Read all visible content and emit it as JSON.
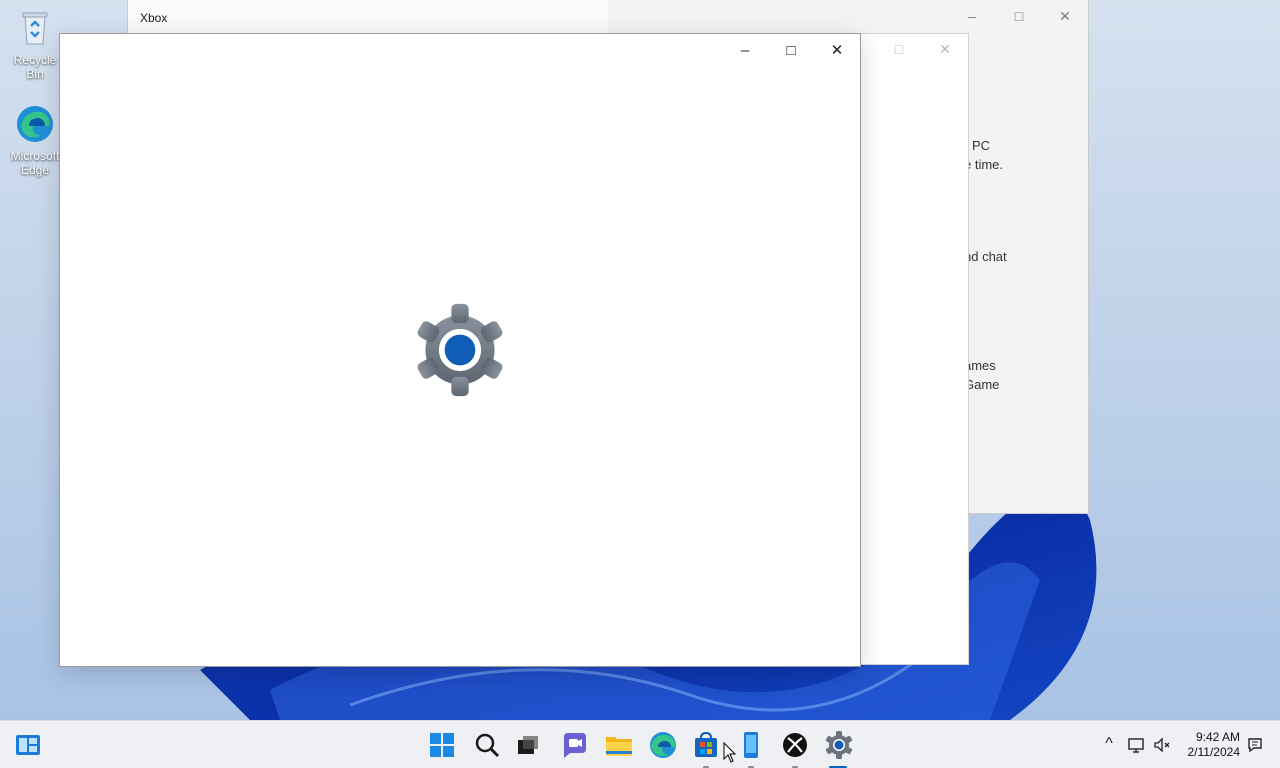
{
  "desktop": {
    "icons": [
      {
        "label": "Recycle Bin"
      },
      {
        "label": "Microsoft Edge"
      }
    ]
  },
  "xbox_window": {
    "title": "Xbox",
    "controls": {
      "minimize": "–",
      "maximize": "□",
      "close": "✕"
    },
    "visible_text": [
      "r PC",
      "e time.",
      "nd chat",
      "ames",
      "Game"
    ]
  },
  "middle_window": {
    "controls": {
      "maximize": "□",
      "close": "✕"
    }
  },
  "settings_window": {
    "controls": {
      "minimize": "–",
      "maximize": "□",
      "close": "✕"
    },
    "splash_icon": "settings-gear-icon"
  },
  "taskbar": {
    "widgets": "widgets-icon",
    "apps": [
      {
        "name": "start-icon"
      },
      {
        "name": "search-icon"
      },
      {
        "name": "task-view-icon"
      },
      {
        "name": "teams-chat-icon"
      },
      {
        "name": "file-explorer-icon"
      },
      {
        "name": "edge-icon"
      },
      {
        "name": "store-icon"
      },
      {
        "name": "phone-link-icon"
      },
      {
        "name": "xbox-icon"
      },
      {
        "name": "settings-icon"
      }
    ],
    "tray": {
      "chevron": "^",
      "time": "9:42 AM",
      "date": "2/11/2024"
    }
  },
  "colors": {
    "accent": "#0067c0",
    "gear_gray": "#6f7a86",
    "gear_center": "#0f5db5"
  }
}
